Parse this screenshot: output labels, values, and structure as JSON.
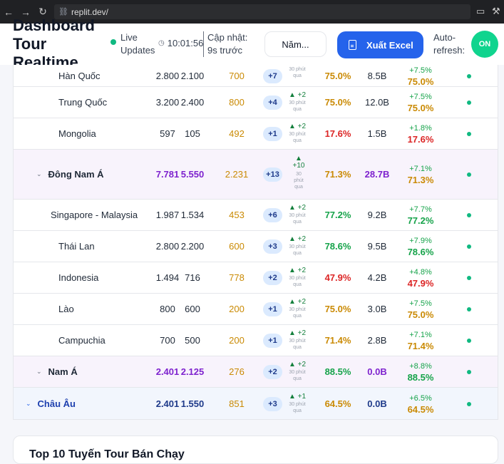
{
  "browser": {
    "url": "replit.dev/"
  },
  "header": {
    "title": "Dashboard Tour Realtime",
    "live_line1": "Live",
    "live_line2": "Updates",
    "clock": "10:01:56",
    "update_line1": "Cập nhật:",
    "update_line2": "9s trước",
    "year_select": "Năm...",
    "export_label": "Xuất Excel",
    "auto_line1": "Auto-",
    "auto_line2": "refresh:",
    "auto_state": "ON"
  },
  "rows": [
    {
      "kind": "country",
      "name": "Hàn Quốc",
      "target": "2.800",
      "sold": "2.100",
      "remaining": "700",
      "pill": "+7",
      "delta": "",
      "delta_sub": "30 phút qua",
      "pct": "75.0%",
      "pct_color": "amber",
      "revenue": "8.5B",
      "growth": "+7.5%",
      "growth_pct": "75.0%",
      "growth_color": "amber"
    },
    {
      "kind": "country",
      "name": "Trung Quốc",
      "target": "3.200",
      "sold": "2.400",
      "remaining": "800",
      "pill": "+4",
      "delta": "▲ +2",
      "delta_sub": "30 phút qua",
      "pct": "75.0%",
      "pct_color": "amber",
      "revenue": "12.0B",
      "growth": "+7.5%",
      "growth_pct": "75.0%",
      "growth_color": "amber"
    },
    {
      "kind": "country",
      "name": "Mongolia",
      "target": "597",
      "sold": "105",
      "remaining": "492",
      "pill": "+1",
      "delta": "▲ +2",
      "delta_sub": "30 phút qua",
      "pct": "17.6%",
      "pct_color": "red",
      "revenue": "1.5B",
      "growth": "+1.8%",
      "growth_pct": "17.6%",
      "growth_color": "red"
    },
    {
      "kind": "region",
      "name": "Đông Nam Á",
      "target": "7.781",
      "sold": "5.550",
      "remaining": "2.231",
      "pill": "+13",
      "delta": "+10",
      "delta_sub": "30 phút qua",
      "pct": "71.3%",
      "pct_color": "amber",
      "revenue": "28.7B",
      "growth": "+7.1%",
      "growth_pct": "71.3%",
      "growth_color": "amber"
    },
    {
      "kind": "country",
      "name": "Singapore - Malaysia",
      "target": "1.987",
      "sold": "1.534",
      "remaining": "453",
      "pill": "+6",
      "delta": "▲ +2",
      "delta_sub": "30 phút qua",
      "pct": "77.2%",
      "pct_color": "green",
      "revenue": "9.2B",
      "growth": "+7.7%",
      "growth_pct": "77.2%",
      "growth_color": "green"
    },
    {
      "kind": "country",
      "name": "Thái Lan",
      "target": "2.800",
      "sold": "2.200",
      "remaining": "600",
      "pill": "+3",
      "delta": "▲ +2",
      "delta_sub": "30 phút qua",
      "pct": "78.6%",
      "pct_color": "green",
      "revenue": "9.5B",
      "growth": "+7.9%",
      "growth_pct": "78.6%",
      "growth_color": "green"
    },
    {
      "kind": "country",
      "name": "Indonesia",
      "target": "1.494",
      "sold": "716",
      "remaining": "778",
      "pill": "+2",
      "delta": "▲ +2",
      "delta_sub": "30 phút qua",
      "pct": "47.9%",
      "pct_color": "red",
      "revenue": "4.2B",
      "growth": "+4.8%",
      "growth_pct": "47.9%",
      "growth_color": "red"
    },
    {
      "kind": "country",
      "name": "Lào",
      "target": "800",
      "sold": "600",
      "remaining": "200",
      "pill": "+1",
      "delta": "▲ +2",
      "delta_sub": "30 phút qua",
      "pct": "75.0%",
      "pct_color": "amber",
      "revenue": "3.0B",
      "growth": "+7.5%",
      "growth_pct": "75.0%",
      "growth_color": "amber"
    },
    {
      "kind": "country",
      "name": "Campuchia",
      "target": "700",
      "sold": "500",
      "remaining": "200",
      "pill": "+1",
      "delta": "▲ +2",
      "delta_sub": "30 phút qua",
      "pct": "71.4%",
      "pct_color": "amber",
      "revenue": "2.8B",
      "growth": "+7.1%",
      "growth_pct": "71.4%",
      "growth_color": "amber"
    },
    {
      "kind": "region",
      "name": "Nam Á",
      "target": "2.401",
      "sold": "2.125",
      "remaining": "276",
      "pill": "+2",
      "delta": "▲ +2",
      "delta_sub": "30 phút qua",
      "pct": "88.5%",
      "pct_color": "green",
      "revenue": "0.0B",
      "growth": "+8.8%",
      "growth_pct": "88.5%",
      "growth_color": "green"
    },
    {
      "kind": "continent",
      "name": "Châu Âu",
      "target": "2.401",
      "sold": "1.550",
      "remaining": "851",
      "pill": "+3",
      "delta": "▲ +1",
      "delta_sub": "30 phút qua",
      "pct": "64.5%",
      "pct_color": "amber",
      "revenue": "0.0B",
      "growth": "+6.5%",
      "growth_pct": "64.5%",
      "growth_color": "amber"
    }
  ],
  "section2": {
    "title": "Top 10 Tuyến Tour Bán Chạy"
  },
  "colors": {
    "live_dot": "#10b981",
    "export_button": "#2563eb",
    "on_toggle": "#10d48e"
  }
}
